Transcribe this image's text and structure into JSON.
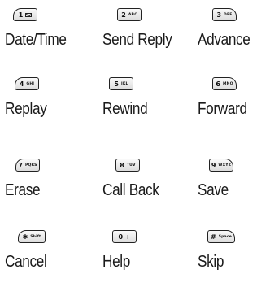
{
  "keys": [
    {
      "num": "1",
      "sub": "",
      "label": "Date/Time",
      "icon": "mail-icon"
    },
    {
      "num": "2",
      "sub": "ABC",
      "label": "Send Reply"
    },
    {
      "num": "3",
      "sub": "DEF",
      "label": "Advance"
    },
    {
      "num": "4",
      "sub": "GHI",
      "label": "Replay"
    },
    {
      "num": "5",
      "sub": "JKL",
      "label": "Rewind"
    },
    {
      "num": "6",
      "sub": "MNO",
      "label": "Forward"
    },
    {
      "num": "7",
      "sub": "PQRS",
      "label": "Erase"
    },
    {
      "num": "8",
      "sub": "TUV",
      "label": "Call Back"
    },
    {
      "num": "9",
      "sub": "WXYZ",
      "label": "Save"
    },
    {
      "num": "✱",
      "sub": "Shift",
      "label": "Cancel"
    },
    {
      "num": "0 +",
      "sub": "",
      "label": "Help"
    },
    {
      "num": "#",
      "sub": "Space",
      "label": "Skip"
    }
  ]
}
